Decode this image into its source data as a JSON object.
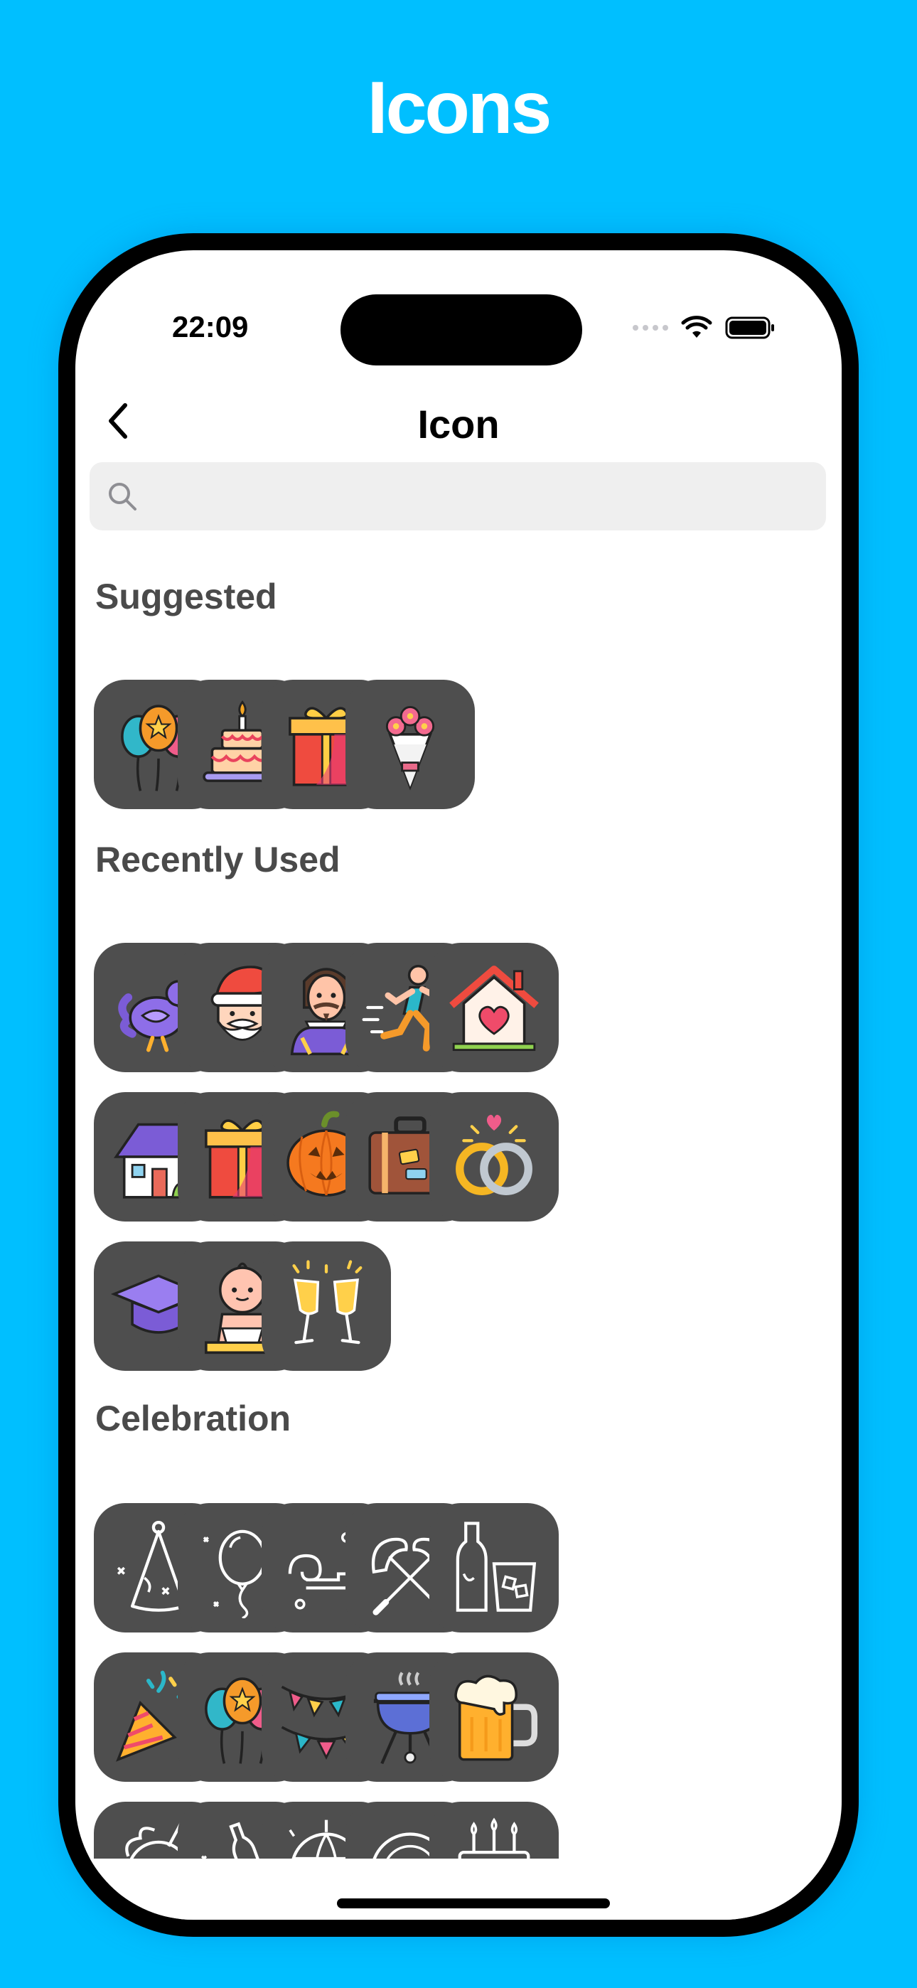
{
  "headline": "Icons",
  "status_bar": {
    "time": "22:09"
  },
  "nav": {
    "title": "Icon"
  },
  "search": {
    "placeholder": "",
    "value": ""
  },
  "sections": {
    "suggested": {
      "title": "Suggested",
      "icons": [
        "balloons-icon",
        "birthday-cake-icon",
        "gift-box-icon",
        "flower-bouquet-icon"
      ]
    },
    "recently_used": {
      "title": "Recently Used",
      "icons": [
        "turkey-icon",
        "santa-claus-icon",
        "shakespeare-icon",
        "runner-icon",
        "home-heart-icon",
        "house-icon",
        "gift-box-icon",
        "jack-o-lantern-icon",
        "suitcase-icon",
        "wedding-rings-icon",
        "graduation-cap-icon",
        "baby-icon",
        "champagne-toast-icon"
      ]
    },
    "celebration": {
      "title": "Celebration",
      "icons": [
        "party-hat-outline-icon",
        "balloon-outline-icon",
        "party-blower-outline-icon",
        "sausage-skewers-outline-icon",
        "drinks-outline-icon",
        "party-popper-icon",
        "balloons-icon",
        "bunting-flags-icon",
        "barbecue-grill-icon",
        "beer-mug-icon",
        "coconut-drink-outline-icon",
        "champagne-bucket-outline-icon",
        "disco-ball-outline-icon",
        "vinyl-record-outline-icon",
        "cake-candles-outline-icon"
      ]
    }
  },
  "colors": {
    "background": "#00bfff",
    "tile": "#4e4e4e",
    "section_title": "#4a4a4a",
    "search_bg": "#efefef"
  }
}
